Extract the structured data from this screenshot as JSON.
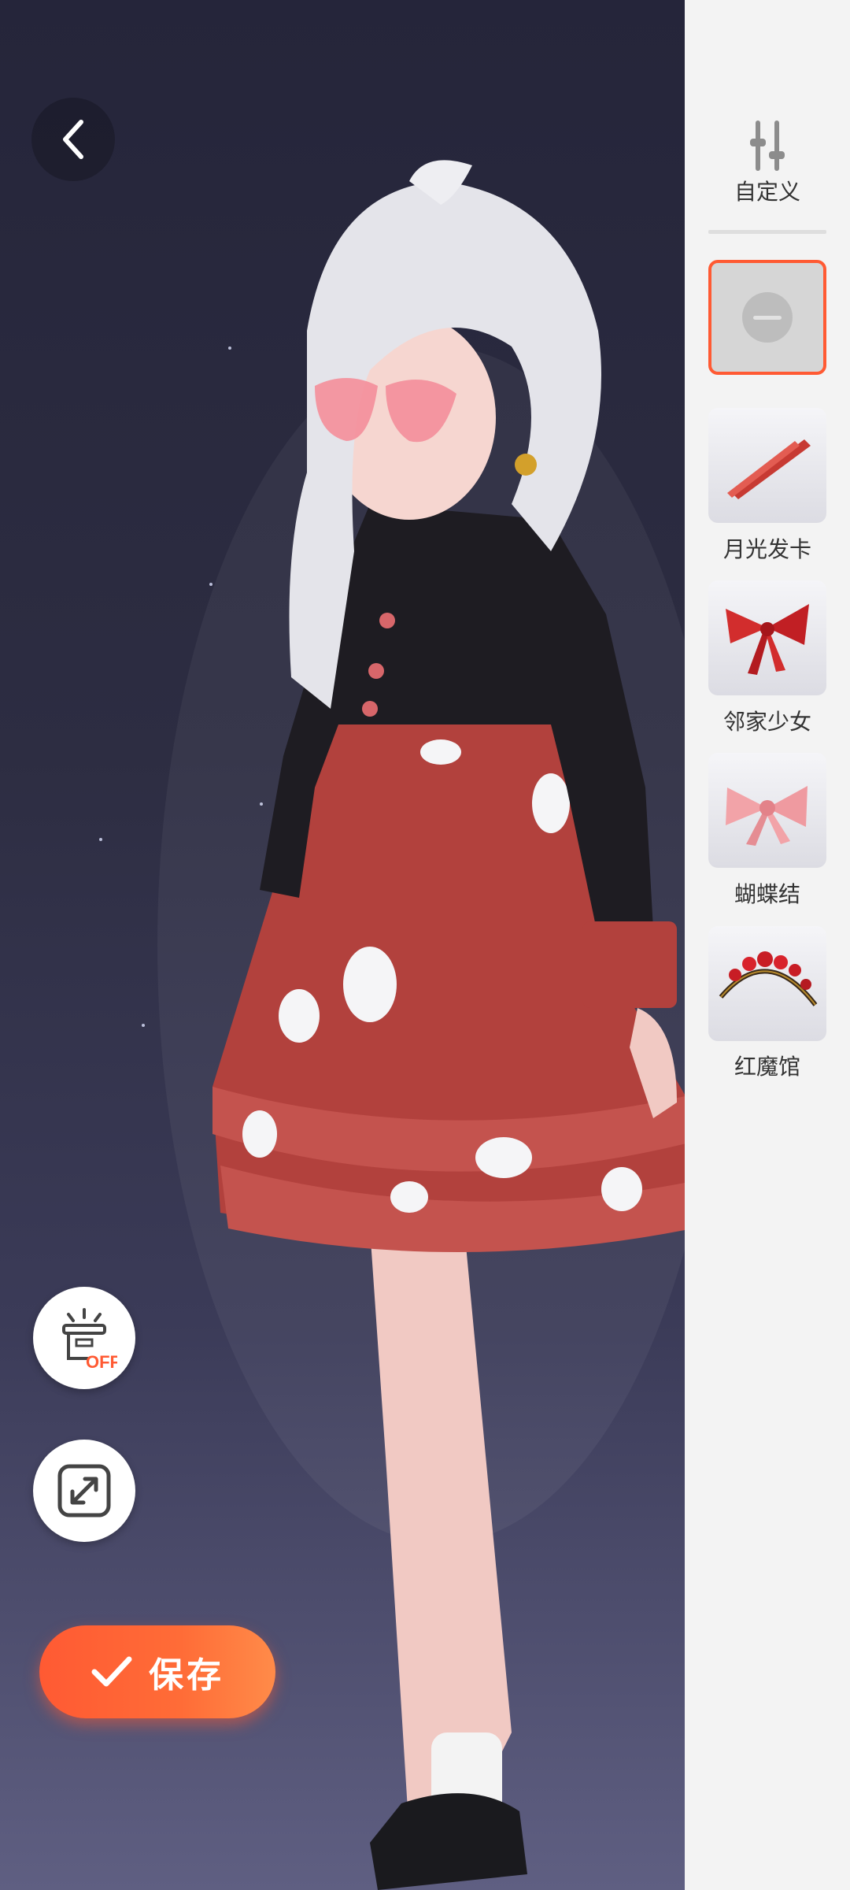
{
  "buttons": {
    "back": "back",
    "save_label": "保存",
    "off_badge": "OFF"
  },
  "panel": {
    "custom_label": "自定义",
    "items": [
      {
        "label": "月光发卡",
        "icon": "hairpin-icon"
      },
      {
        "label": "邻家少女",
        "icon": "red-bow-icon"
      },
      {
        "label": "蝴蝶结",
        "icon": "pink-bow-icon"
      },
      {
        "label": "红魔馆",
        "icon": "tiara-icon"
      }
    ],
    "selected": "none"
  },
  "colors": {
    "accent": "#ff5a33",
    "panel_bg": "#f3f3f3"
  }
}
